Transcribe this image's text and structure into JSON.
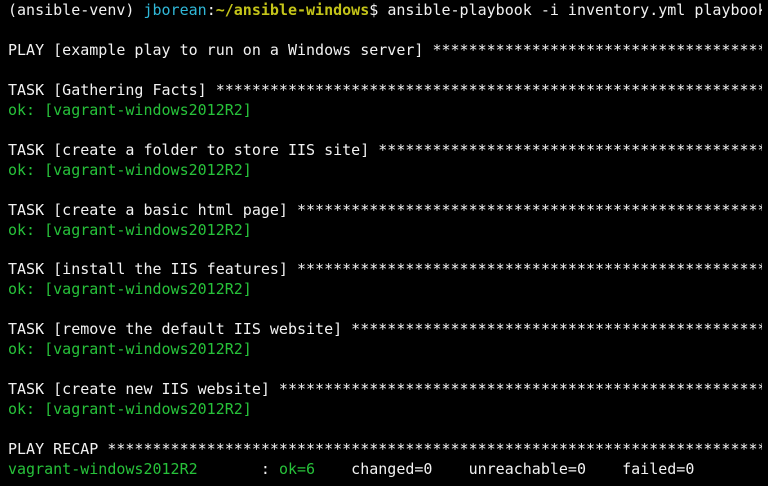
{
  "prompt": {
    "venv": "(ansible-venv)",
    "user": "jborean",
    "sep": ":",
    "cwd": "~/ansible-windows",
    "symbol": "$",
    "command": "ansible-playbook -i inventory.yml playbook.yml"
  },
  "play": {
    "line": "PLAY [example play to run on a Windows server] ********************************************"
  },
  "tasks": [
    {
      "header": "TASK [Gathering Facts] *****************************************************************************",
      "result": "ok: [vagrant-windows2012R2]"
    },
    {
      "header": "TASK [create a folder to store IIS site] ***************************************************",
      "result": "ok: [vagrant-windows2012R2]"
    },
    {
      "header": "TASK [create a basic html page] ************************************************************",
      "result": "ok: [vagrant-windows2012R2]"
    },
    {
      "header": "TASK [install the IIS features] ************************************************************",
      "result": "ok: [vagrant-windows2012R2]"
    },
    {
      "header": "TASK [remove the default IIS website] *****************************************************",
      "result": "ok: [vagrant-windows2012R2]"
    },
    {
      "header": "TASK [create new IIS website] **************************************************************",
      "result": "ok: [vagrant-windows2012R2]"
    }
  ],
  "recap": {
    "line": "PLAY RECAP *****************************************************************************************",
    "host": "vagrant-windows2012R2",
    "colon": "       : ",
    "ok": "ok=6",
    "changed": "    changed=0",
    "unreachable": "    unreachable=0",
    "failed": "    failed=0"
  },
  "colors": {
    "background": "#000000",
    "text": "#f2f2f2",
    "ok_green": "#27c23a",
    "user_cyan": "#30b8d8",
    "cwd_yellow": "#c4c419"
  }
}
